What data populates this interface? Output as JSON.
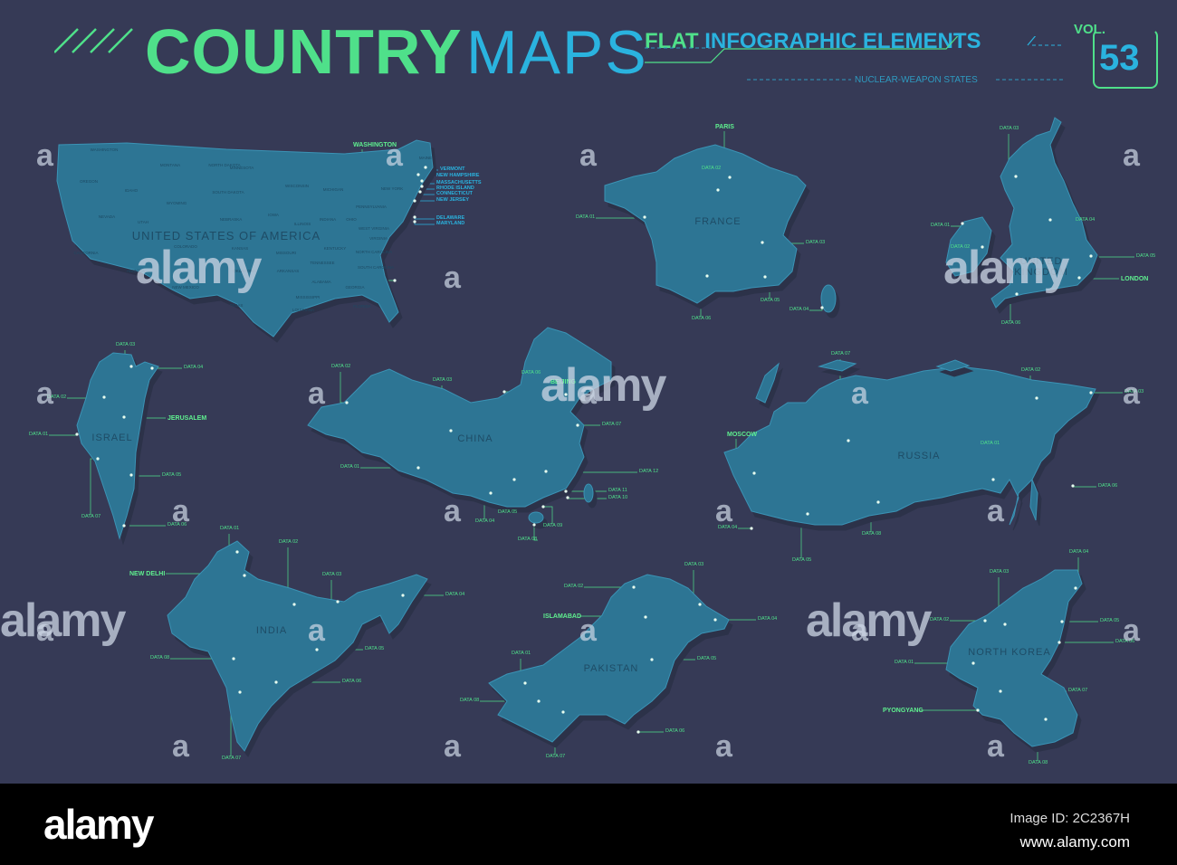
{
  "header": {
    "title_country": "COUNTRY",
    "title_maps": "MAPS",
    "subtitle_flat": "FLAT",
    "subtitle_rest": "INFOGRAPHIC ELEMENTS",
    "tagline": "NUCLEAR-WEAPON STATES",
    "vol_label": "VOL.",
    "vol_number": "53"
  },
  "colors": {
    "background": "#363a56",
    "land": "#2d7594",
    "accent_green": "#4fe08a",
    "accent_blue": "#2ab3df"
  },
  "countries": {
    "usa": {
      "name": "UNITED STATES OF AMERICA",
      "states": [
        "WASHINGTON",
        "MONTANA",
        "NORTH DAKOTA",
        "MINNESOTA",
        "OREGON",
        "IDAHO",
        "WYOMING",
        "SOUTH DAKOTA",
        "WISCONSIN",
        "MICHIGAN",
        "NEW YORK",
        "NEVADA",
        "UTAH",
        "NEBRASKA",
        "IOWA",
        "ILLINOIS",
        "INDIANA",
        "OHIO",
        "PENNSYLVANIA",
        "CALIFORNIA",
        "COLORADO",
        "KANSAS",
        "MISSOURI",
        "KENTUCKY",
        "WEST VIRGINIA",
        "VIRGINIA",
        "ARIZONA",
        "OKLAHOMA",
        "ARKANSAS",
        "TENNESSEE",
        "NORTH CAROLINA",
        "SOUTH CAROLINA",
        "TEXAS",
        "NEW MEXICO",
        "ALABAMA",
        "GEORGIA",
        "MISSISSIPPI",
        "LOUISIANA",
        "FLORIDA",
        "MAINE"
      ],
      "callouts": [
        "WASHINGTON",
        "VERMONT",
        "NEW HAMPSHIRE",
        "MASSACHUSETTS",
        "RHODE ISLAND",
        "CONNECTICUT",
        "NEW JERSEY",
        "DELAWARE",
        "MARYLAND"
      ]
    },
    "france": {
      "name": "FRANCE",
      "callouts": [
        "PARIS",
        "DATA 02",
        "DATA 01",
        "DATA 03",
        "DATA 04",
        "DATA 05",
        "DATA 06"
      ]
    },
    "uk": {
      "name": "UNITED KINGDOM",
      "callouts": [
        "DATA 03",
        "DATA 01",
        "DATA 04",
        "DATA 02",
        "DATA 05",
        "LONDON",
        "DATA 06"
      ]
    },
    "israel": {
      "name": "ISRAEL",
      "callouts": [
        "DATA 03",
        "DATA 04",
        "DATA 02",
        "JERUSALEM",
        "DATA 01",
        "DATA 05",
        "DATA 07",
        "DATA 06"
      ]
    },
    "china": {
      "name": "CHINA",
      "callouts": [
        "DATA 02",
        "DATA 03",
        "DATA 06",
        "BEIJING",
        "DATA 07",
        "DATA 01",
        "DATA 12",
        "DATA 11",
        "DATA 10",
        "DATA 05",
        "DATA 04",
        "DATA 09",
        "DATA 08"
      ]
    },
    "russia": {
      "name": "RUSSIA",
      "callouts": [
        "DATA 07",
        "DATA 02",
        "DATA 03",
        "MOSCOW",
        "DATA 01",
        "DATA 06",
        "DATA 04",
        "DATA 08",
        "DATA 05"
      ]
    },
    "india": {
      "name": "INDIA",
      "callouts": [
        "DATA 01",
        "DATA 02",
        "NEW DELHI",
        "DATA 03",
        "DATA 04",
        "DATA 05",
        "DATA 08",
        "DATA 06",
        "DATA 07"
      ]
    },
    "pakistan": {
      "name": "PAKISTAN",
      "callouts": [
        "DATA 03",
        "DATA 02",
        "ISLAMABAD",
        "DATA 04",
        "DATA 01",
        "DATA 05",
        "DATA 08",
        "DATA 06",
        "DATA 07"
      ]
    },
    "north_korea": {
      "name": "NORTH KOREA",
      "callouts": [
        "DATA 04",
        "DATA 03",
        "DATA 02",
        "DATA 05",
        "DATA 06",
        "DATA 01",
        "DATA 07",
        "PYONGYANG",
        "DATA 08"
      ]
    }
  },
  "watermark": "alamy",
  "watermark_mark": "a",
  "footer": {
    "logo": "alamy",
    "image_id": "Image ID: 2C2367H",
    "url": "www.alamy.com"
  }
}
